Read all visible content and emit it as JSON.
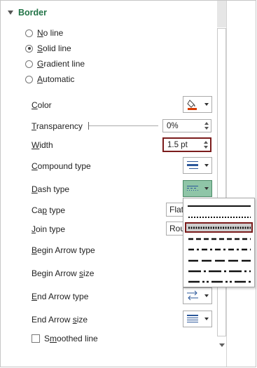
{
  "section": {
    "title": "Border"
  },
  "line_options": [
    {
      "hotkey": "N",
      "rest": "o line",
      "checked": false
    },
    {
      "hotkey": "S",
      "rest": "olid line",
      "checked": true
    },
    {
      "hotkey": "G",
      "rest": "radient line",
      "checked": false
    },
    {
      "hotkey": "A",
      "rest": "utomatic",
      "checked": false
    }
  ],
  "properties": {
    "color": {
      "hotkey": "C",
      "rest": "olor",
      "icon": "paint-bucket-icon",
      "accent": "#d83b01"
    },
    "transparency": {
      "hotkey": "T",
      "rest": "ransparency",
      "value": "0%"
    },
    "width": {
      "hotkey": "W",
      "rest": "idth",
      "value": "1.5 pt"
    },
    "compound_type": {
      "hotkey": "C",
      "rest": "ompound type",
      "icon": "compound-lines-icon"
    },
    "dash_type": {
      "hotkey": "D",
      "rest": "ash type",
      "icon": "dash-type-icon"
    },
    "cap_type": {
      "pre": "Ca",
      "hotkey": "p",
      "rest": " type",
      "value": "Flat"
    },
    "join_type": {
      "hotkey": "J",
      "rest": "oin type",
      "value": "Round"
    },
    "begin_arrow_type": {
      "hotkey": "B",
      "rest": "egin Arrow type"
    },
    "begin_arrow_size": {
      "pre": "Begin Arrow ",
      "hotkey": "s",
      "rest": "ize"
    },
    "end_arrow_type": {
      "hotkey": "E",
      "rest": "nd Arrow type",
      "icon": "arrows-icon"
    },
    "end_arrow_size": {
      "pre": "End Arrow ",
      "hotkey": "s",
      "rest": "ize",
      "icon": "lines-icon"
    }
  },
  "smoothed_line": {
    "hotkey": "m",
    "pre": "S",
    "rest": "oothed line",
    "checked": false
  },
  "dash_menu": {
    "items": [
      "solid",
      "round-dot",
      "square-dot",
      "dash",
      "dash-dot",
      "long-dash",
      "long-dash-dot",
      "long-dash-dot-dot"
    ],
    "selected_index": 2
  },
  "colors": {
    "accent": "#217346",
    "selection": "#7b1c1c",
    "active_button": "#8fc5a7"
  }
}
